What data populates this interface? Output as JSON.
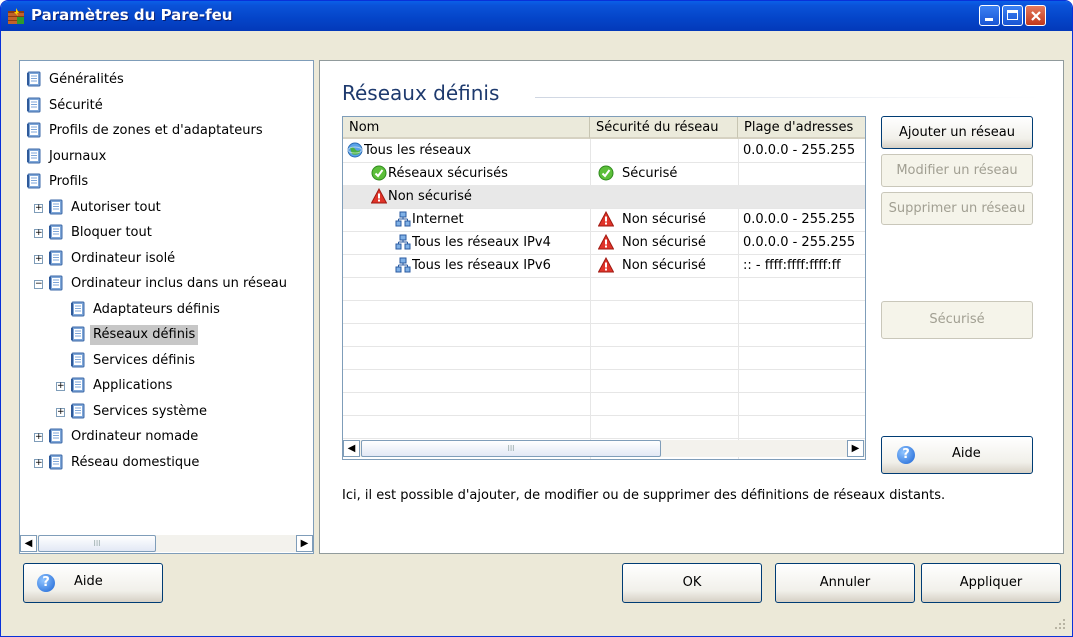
{
  "window": {
    "title": "Paramètres du Pare-feu"
  },
  "tree": {
    "items": [
      {
        "label": "Généralités",
        "level": 0,
        "expander": "",
        "selected": false
      },
      {
        "label": "Sécurité",
        "level": 0,
        "expander": "",
        "selected": false
      },
      {
        "label": "Profils de zones et d'adaptateurs",
        "level": 0,
        "expander": "",
        "selected": false
      },
      {
        "label": "Journaux",
        "level": 0,
        "expander": "",
        "selected": false
      },
      {
        "label": "Profils",
        "level": 0,
        "expander": "",
        "selected": false
      },
      {
        "label": "Autoriser tout",
        "level": 1,
        "expander": "+",
        "selected": false
      },
      {
        "label": "Bloquer tout",
        "level": 1,
        "expander": "+",
        "selected": false
      },
      {
        "label": "Ordinateur isolé",
        "level": 1,
        "expander": "+",
        "selected": false
      },
      {
        "label": "Ordinateur inclus dans un réseau",
        "level": 1,
        "expander": "−",
        "selected": false
      },
      {
        "label": "Adaptateurs définis",
        "level": 2,
        "expander": "",
        "selected": false
      },
      {
        "label": "Réseaux définis",
        "level": 2,
        "expander": "",
        "selected": true
      },
      {
        "label": "Services définis",
        "level": 2,
        "expander": "",
        "selected": false
      },
      {
        "label": "Applications",
        "level": 2,
        "expander": "+",
        "selected": false
      },
      {
        "label": "Services système",
        "level": 2,
        "expander": "+",
        "selected": false
      },
      {
        "label": "Ordinateur nomade",
        "level": 1,
        "expander": "+",
        "selected": false
      },
      {
        "label": "Réseau domestique",
        "level": 1,
        "expander": "+",
        "selected": false
      }
    ],
    "scrollbar_thumb_label": "III"
  },
  "main": {
    "title": "Réseaux définis",
    "columns": [
      "Nom",
      "Sécurité du réseau",
      "Plage d'adresses"
    ],
    "rows": [
      {
        "name": "Tous les réseaux",
        "indent": 0,
        "icon": "globe-icon",
        "security": "",
        "sec_icon": "",
        "range": "0.0.0.0 - 255.255",
        "group": false
      },
      {
        "name": "Réseaux sécurisés",
        "indent": 1,
        "icon": "check-icon",
        "security": "Sécurisé",
        "sec_icon": "check-icon",
        "range": "",
        "group": false
      },
      {
        "name": "Non sécurisé",
        "indent": 1,
        "icon": "warning-icon",
        "security": "",
        "sec_icon": "",
        "range": "",
        "group": true
      },
      {
        "name": "Internet",
        "indent": 2,
        "icon": "network-icon",
        "security": "Non sécurisé",
        "sec_icon": "warning-icon",
        "range": "0.0.0.0 - 255.255",
        "group": false
      },
      {
        "name": "Tous les réseaux IPv4",
        "indent": 2,
        "icon": "network-icon",
        "security": "Non sécurisé",
        "sec_icon": "warning-icon",
        "range": "0.0.0.0 - 255.255",
        "group": false
      },
      {
        "name": "Tous les réseaux IPv6",
        "indent": 2,
        "icon": "network-icon",
        "security": "Non sécurisé",
        "sec_icon": "warning-icon",
        "range": ":: - ffff:ffff:ffff:ff",
        "group": false
      }
    ],
    "scrollbar_thumb_label": "III",
    "description": "Ici, il est possible d'ajouter, de modifier ou de supprimer des définitions de réseaux distants."
  },
  "buttons": {
    "add_network": "Ajouter un réseau",
    "edit_network": "Modifier un réseau",
    "delete_network": "Supprimer un réseau",
    "secure": "Sécurisé",
    "help_panel": "Aide",
    "help_footer": "Aide",
    "ok": "OK",
    "cancel": "Annuler",
    "apply": "Appliquer"
  },
  "colors": {
    "titlebar": "#0a52d8",
    "selection": "#c7c7c7",
    "heading": "#1e3a6e",
    "safe": "#4caf2a",
    "warning": "#d9261c"
  }
}
